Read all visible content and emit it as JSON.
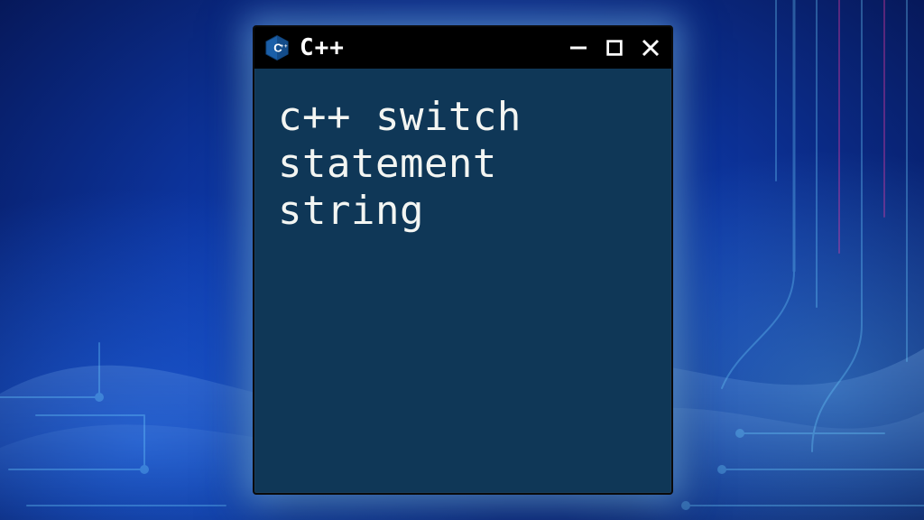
{
  "window": {
    "title": "C++",
    "icon_name": "cpp-hex-icon",
    "controls": {
      "minimize_label": "Minimize",
      "maximize_label": "Maximize",
      "close_label": "Close"
    }
  },
  "body": {
    "text": "c++ switch\nstatement\nstring"
  },
  "colors": {
    "window_bg": "#0f3757",
    "titlebar_bg": "#000000",
    "text": "#f3f5f2",
    "cpp_icon_fill": "#1b5fa8",
    "glow": "#7cc2ff"
  }
}
